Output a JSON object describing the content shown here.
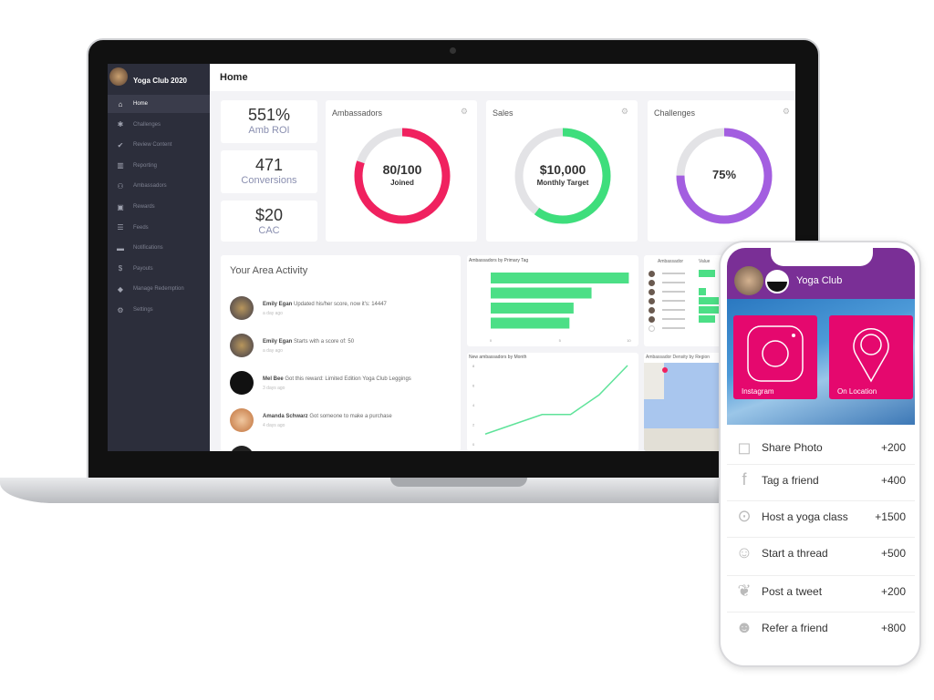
{
  "app": {
    "club_name": "Yoga Club 2020",
    "page_title": "Home"
  },
  "sidebar": {
    "items": [
      {
        "label": "Home",
        "icon": "home-icon",
        "active": true
      },
      {
        "label": "Challenges",
        "icon": "puzzle-icon"
      },
      {
        "label": "Review Content",
        "icon": "check-circle-icon"
      },
      {
        "label": "Reporting",
        "icon": "bar-chart-icon"
      },
      {
        "label": "Ambassadors",
        "icon": "users-icon"
      },
      {
        "label": "Rewards",
        "icon": "gift-icon"
      },
      {
        "label": "Feeds",
        "icon": "feed-icon"
      },
      {
        "label": "Notifications",
        "icon": "chat-icon"
      },
      {
        "label": "Payouts",
        "icon": "dollar-icon"
      },
      {
        "label": "Manage Redemption",
        "icon": "tag-icon"
      },
      {
        "label": "Settings",
        "icon": "gear-icon"
      }
    ]
  },
  "kpis": [
    {
      "value": "551%",
      "label": "Amb ROI"
    },
    {
      "value": "471",
      "label": "Conversions"
    },
    {
      "value": "$20",
      "label": "CAC"
    }
  ],
  "donuts": [
    {
      "title": "Ambassadors",
      "value": "80/100",
      "label": "Joined",
      "progress": 0.8,
      "color": "#f0215f"
    },
    {
      "title": "Sales",
      "value": "$10,000",
      "label": "Monthly Target",
      "progress": 0.6,
      "color": "#3ede7c"
    },
    {
      "title": "Challenges",
      "value": "75%",
      "label": "",
      "progress": 0.75,
      "color": "#a35ee0"
    }
  ],
  "activity": {
    "title": "Your Area Activity",
    "items": [
      {
        "name": "Emily Egan",
        "text": "Updated his/her score, now it's: 14447",
        "ago": "a day ago"
      },
      {
        "name": "Emily Egan",
        "text": "Starts with a score of: 50",
        "ago": "a day ago"
      },
      {
        "name": "Mel Bee",
        "text": "Got this reward: Limited Edition Yoga Club Leggings",
        "ago": "3 days ago"
      },
      {
        "name": "Amanda Schwarz",
        "text": "Got someone to make a purchase",
        "ago": "4 days ago"
      }
    ]
  },
  "chart_data": [
    {
      "type": "bar",
      "title": "Ambassadors by Primary Tag",
      "orientation": "horizontal",
      "values": [
        10,
        7.3,
        6,
        5.7
      ],
      "xlim": [
        0,
        10.5
      ],
      "x_ticks": [
        0,
        5,
        10
      ],
      "color": "#4cdf86"
    },
    {
      "type": "line",
      "title": "New ambassadors by Month",
      "values": [
        1,
        2,
        3,
        3,
        5,
        8
      ],
      "ylim": [
        0,
        8
      ],
      "y_ticks": [
        0,
        2,
        4,
        6,
        8
      ],
      "color": "#5fe39a"
    }
  ],
  "table": {
    "headers": [
      "Ambassador",
      "Value"
    ],
    "values": [
      0.6,
      0,
      0.25,
      1,
      1,
      0.6,
      0
    ]
  },
  "map": {
    "title": "Ambassador Density by Region"
  },
  "phone": {
    "title": "Yoga Club",
    "tiles": [
      {
        "label": "Instagram",
        "icon": "instagram-icon"
      },
      {
        "label": "On Location",
        "icon": "location-pin-icon"
      }
    ],
    "actions": [
      {
        "label": "Share Photo",
        "points": "+200",
        "icon": "instagram-icon"
      },
      {
        "label": "Tag a friend",
        "points": "+400",
        "icon": "facebook-icon"
      },
      {
        "label": "Host a yoga class",
        "points": "+1500",
        "icon": "location-pin-icon"
      },
      {
        "label": "Start a thread",
        "points": "+500",
        "icon": "reddit-icon"
      },
      {
        "label": "Post a tweet",
        "points": "+200",
        "icon": "twitter-icon"
      },
      {
        "label": "Refer a friend",
        "points": "+800",
        "icon": "smile-icon"
      }
    ],
    "accent": "#e5086e",
    "header_color": "#7a2f96"
  }
}
